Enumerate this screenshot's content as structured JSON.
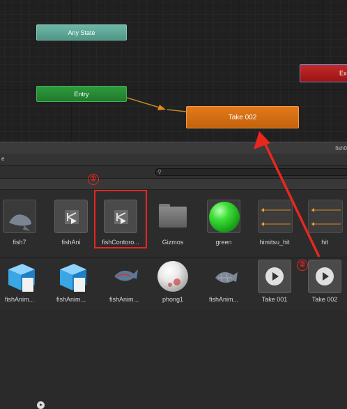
{
  "animator": {
    "nodes": {
      "any_state": "Any State",
      "entry": "Entry",
      "take002": "Take 002",
      "exit": "Ex"
    }
  },
  "header_bar_text": "fish0",
  "project_toolbar_text": "e",
  "assets_row1": [
    {
      "label": "fish7",
      "icon": "fish-model-icon"
    },
    {
      "label": "fishAni",
      "icon": "animator-controller-icon"
    },
    {
      "label": "fishContoro...",
      "icon": "animator-controller-icon"
    },
    {
      "label": "Gizmos",
      "icon": "folder-icon"
    },
    {
      "label": "green",
      "icon": "material-sphere-icon"
    },
    {
      "label": "himitsu_hit",
      "icon": "animation-clip-icon"
    },
    {
      "label": "hit",
      "icon": "animation-clip-icon"
    }
  ],
  "assets_row2": [
    {
      "label": "fishAnim...",
      "icon": "prefab-cube-icon"
    },
    {
      "label": "fishAnim...",
      "icon": "prefab-cube-icon"
    },
    {
      "label": "fishAnim...",
      "icon": "fish-mesh-icon"
    },
    {
      "label": "phong1",
      "icon": "material-sphere-icon"
    },
    {
      "label": "fishAnim...",
      "icon": "fish-mesh-icon"
    },
    {
      "label": "Take 001",
      "icon": "animation-take-icon"
    },
    {
      "label": "Take 002",
      "icon": "animation-take-icon"
    }
  ],
  "annotations": {
    "marker1": "①",
    "marker2": "②"
  },
  "colors": {
    "highlight_red": "#e8271f",
    "state_orange": "#d96f14",
    "entry_green": "#2a8a38",
    "any_state_teal": "#5ea898"
  }
}
